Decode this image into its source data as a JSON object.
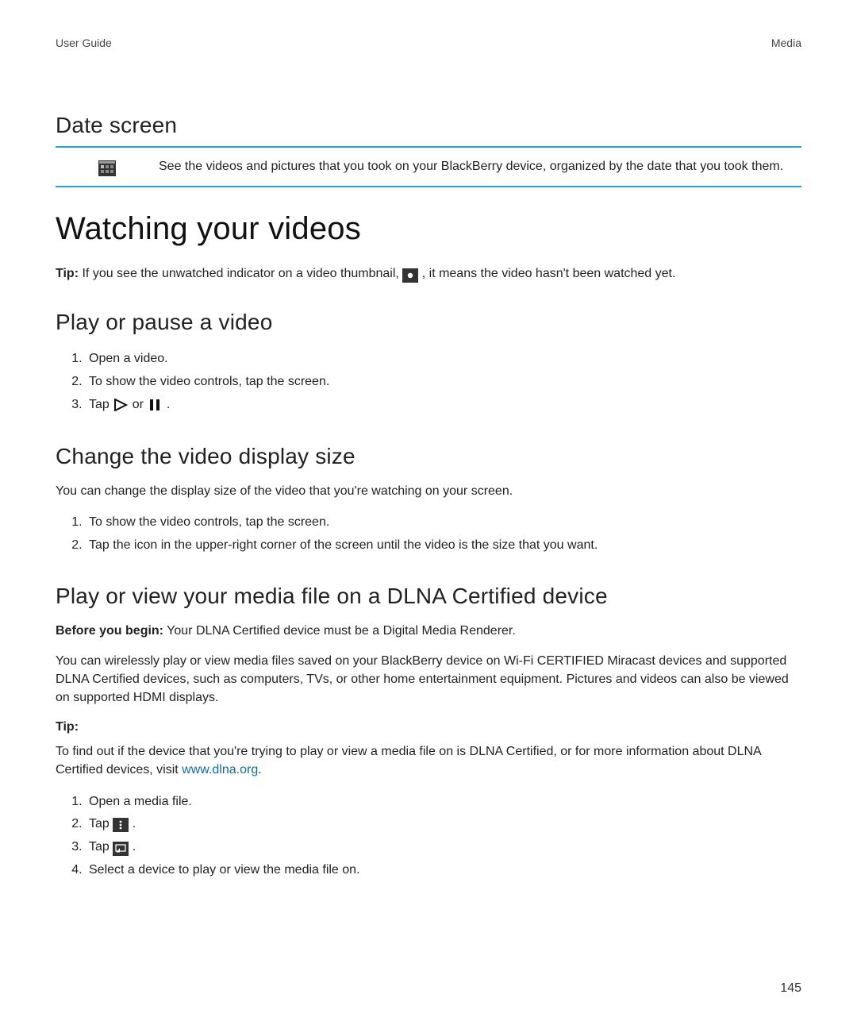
{
  "header": {
    "left": "User Guide",
    "right": "Media"
  },
  "date_section": {
    "title": "Date screen",
    "description": "See the videos and pictures that you took on your BlackBerry device, organized by the date that you took them."
  },
  "main": {
    "title": "Watching your videos"
  },
  "tip_line": {
    "label": "Tip:",
    "before": " If you see the unwatched indicator on a video thumbnail, ",
    "after": " , it means the video hasn't been watched yet."
  },
  "play_pause": {
    "title": "Play or pause a video",
    "steps": {
      "s1": "Open a video.",
      "s2": "To show the video controls, tap the screen.",
      "s3_a": "Tap ",
      "s3_or": " or ",
      "s3_end": " ."
    }
  },
  "display_size": {
    "title": "Change the video display size",
    "intro": "You can change the display size of the video that you're watching on your screen.",
    "steps": {
      "s1": "To show the video controls, tap the screen.",
      "s2": "Tap the icon in the upper-right corner of the screen until the video is the size that you want."
    }
  },
  "dlna": {
    "title": "Play or view your media file on a DLNA Certified device",
    "before_label": "Before you begin:",
    "before_text": " Your DLNA Certified device must be a Digital Media Renderer.",
    "p1": "You can wirelessly play or view media files saved on your BlackBerry device on Wi-Fi CERTIFIED Miracast devices and supported DLNA Certified devices, such as computers, TVs, or other home entertainment equipment. Pictures and videos can also be viewed on supported HDMI displays.",
    "tip_label": "Tip:",
    "p2_a": "To find out if the device that you're trying to play or view a media file on is DLNA Certified, or for more information about DLNA Certified devices, visit ",
    "p2_link": "www.dlna.org",
    "p2_b": ".",
    "steps": {
      "s1": "Open a media file.",
      "s2_a": "Tap ",
      "s2_end": " .",
      "s3_a": "Tap ",
      "s3_end": " .",
      "s4": "Select a device to play or view the media file on."
    }
  },
  "page_number": "145"
}
